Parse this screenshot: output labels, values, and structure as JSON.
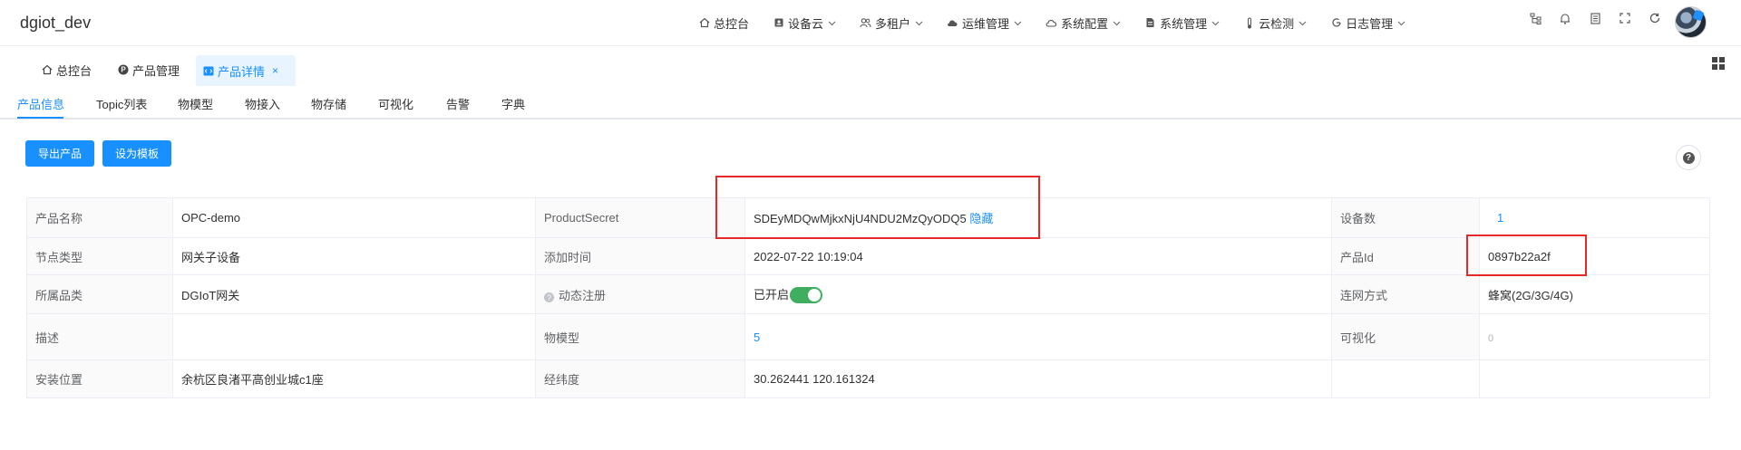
{
  "app": {
    "title": "dgiot_dev"
  },
  "nav": {
    "items": [
      {
        "label": "总控台",
        "icon": "home-icon",
        "has_dropdown": false
      },
      {
        "label": "设备云",
        "icon": "device-icon",
        "has_dropdown": true
      },
      {
        "label": "多租户",
        "icon": "users-icon",
        "has_dropdown": true
      },
      {
        "label": "运维管理",
        "icon": "cloud-icon",
        "has_dropdown": true
      },
      {
        "label": "系统配置",
        "icon": "cloud-outline-icon",
        "has_dropdown": true
      },
      {
        "label": "系统管理",
        "icon": "document-icon",
        "has_dropdown": true
      },
      {
        "label": "云检测",
        "icon": "thermometer-icon",
        "has_dropdown": true
      },
      {
        "label": "日志管理",
        "icon": "refresh-log-icon",
        "has_dropdown": true
      }
    ],
    "tools": [
      "tree-icon",
      "bell-icon",
      "book-icon",
      "fullscreen-icon",
      "refresh-icon"
    ]
  },
  "tags": [
    {
      "label": "总控台",
      "icon": "home-icon"
    },
    {
      "label": "产品管理",
      "icon": "product-icon"
    },
    {
      "label": "产品详情",
      "icon": "code-icon",
      "close": "×"
    }
  ],
  "subtabs": [
    "产品信息",
    "Topic列表",
    "物模型",
    "物接入",
    "物存储",
    "可视化",
    "告警",
    "字典"
  ],
  "buttons": {
    "export": "导出产品",
    "template": "设为模板",
    "help": "?"
  },
  "detail": {
    "product_name_label": "产品名称",
    "product_name": "OPC-demo",
    "secret_label": "ProductSecret",
    "secret": "SDEyMDQwMjkxNjU4NDU2MzQyODQ5",
    "secret_toggle": "隐藏",
    "device_count_label": "设备数",
    "device_count": "1",
    "node_type_label": "节点类型",
    "node_type": "网关子设备",
    "created_label": "添加时间",
    "created": "2022-07-22 10:19:04",
    "product_id_label": "产品Id",
    "product_id": "0897b22a2f",
    "category_label": "所属品类",
    "category": "DGIoT网关",
    "dynamic_reg_label": "动态注册",
    "dynamic_reg": "已开启",
    "network_label": "连网方式",
    "network": "蜂窝(2G/3G/4G)",
    "desc_label": "描述",
    "desc": "",
    "thing_model_label": "物模型",
    "thing_model": "5",
    "visual_label": "可视化",
    "visual": "0",
    "location_label": "安装位置",
    "location": "余杭区良渚平高创业城c1座",
    "coords_label": "经纬度",
    "coords": "30.262441 120.161324"
  },
  "colors": {
    "accent": "#1890ff",
    "success": "#13ce66",
    "annotation": "#e62828"
  }
}
